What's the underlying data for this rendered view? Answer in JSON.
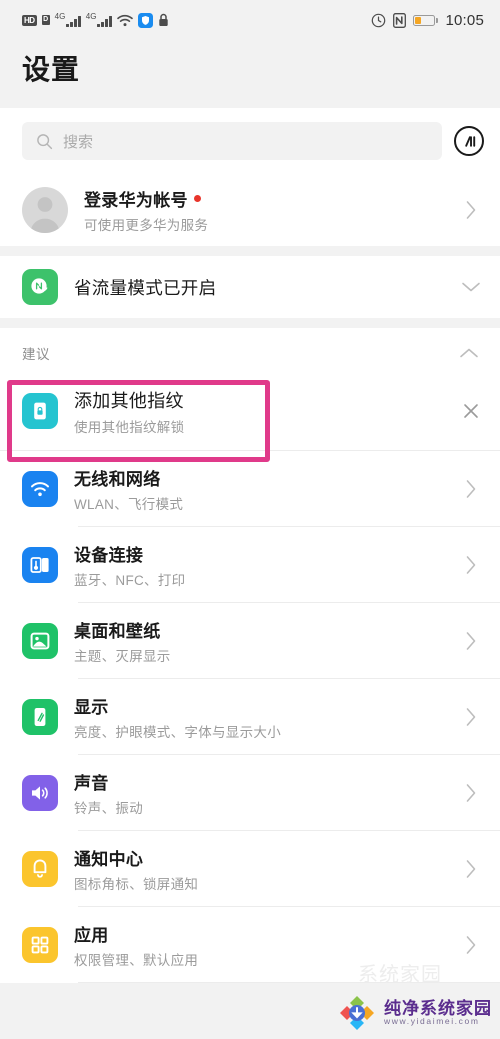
{
  "statusbar": {
    "hd_label": "HD",
    "sim_label": "D",
    "net1_label": "4G",
    "net2_label": "4G",
    "icons": [
      "hd-icon",
      "sim-icon",
      "signal-4g-icon",
      "signal-4g-secondary-icon",
      "wifi-icon",
      "shield-icon",
      "lock-icon",
      "alarm-icon",
      "nfc-icon",
      "battery-icon"
    ],
    "time": "10:05"
  },
  "header": {
    "title": "设置"
  },
  "search": {
    "placeholder": "搜索",
    "scan_icon": "scan-code-icon"
  },
  "account": {
    "title": "登录华为帐号",
    "subtitle": "可使用更多华为服务",
    "has_badge": true
  },
  "datasaver": {
    "title": "省流量模式已开启",
    "icon_color": "#3dc26b"
  },
  "suggestions": {
    "section_label": "建议",
    "collapse_icon": "chevron-up-icon",
    "items": [
      {
        "title": "添加其他指纹",
        "subtitle": "使用其他指纹解锁",
        "icon": "fingerprint-phone-icon",
        "icon_color": "#25c4d0",
        "dismiss_icon": "close-icon",
        "highlighted": true
      }
    ],
    "highlight_color": "#e03a8a"
  },
  "settings": {
    "items": [
      {
        "title": "无线和网络",
        "subtitle": "WLAN、飞行模式",
        "icon": "wifi-icon",
        "icon_color": "#1a83f0"
      },
      {
        "title": "设备连接",
        "subtitle": "蓝牙、NFC、打印",
        "icon": "device-connect-icon",
        "icon_color": "#1a83f0"
      },
      {
        "title": "桌面和壁纸",
        "subtitle": "主题、灭屏显示",
        "icon": "wallpaper-icon",
        "icon_color": "#1fc268"
      },
      {
        "title": "显示",
        "subtitle": "亮度、护眼模式、字体与显示大小",
        "icon": "display-icon",
        "icon_color": "#1fc268"
      },
      {
        "title": "声音",
        "subtitle": "铃声、振动",
        "icon": "sound-icon",
        "icon_color": "#8261e8"
      },
      {
        "title": "通知中心",
        "subtitle": "图标角标、锁屏通知",
        "icon": "bell-icon",
        "icon_color": "#fbc52d"
      },
      {
        "title": "应用",
        "subtitle": "权限管理、默认应用",
        "icon": "apps-grid-icon",
        "icon_color": "#fbc52d"
      }
    ],
    "chevron_icon": "chevron-right-icon"
  },
  "watermark": {
    "title": "纯净系统家园",
    "url": "www.yidaimei.com",
    "faint_text": "系统家园"
  },
  "colors": {
    "page_bg": "#f2f2f2",
    "card_bg": "#ffffff",
    "title_text": "#1a1a1a",
    "sub_text": "#9b9b9b",
    "divider": "#ececec"
  }
}
